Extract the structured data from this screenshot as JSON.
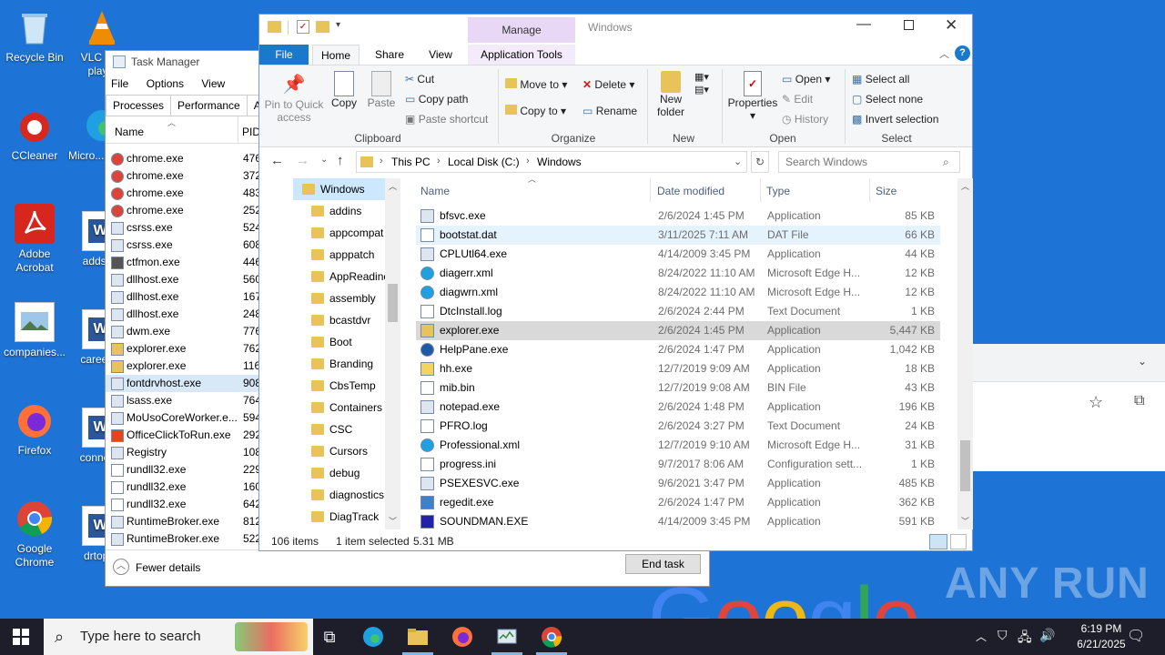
{
  "desktop": {
    "icons": [
      {
        "label": "Recycle Bin"
      },
      {
        "label": "VLC m... play..."
      },
      {
        "label": "CCleaner"
      },
      {
        "label": "Micro... Edg..."
      },
      {
        "label": "Adobe Acrobat"
      },
      {
        "label": "addsh..."
      },
      {
        "label": "companies..."
      },
      {
        "label": "careerf..."
      },
      {
        "label": "Firefox"
      },
      {
        "label": "connec..."
      },
      {
        "label": "Google Chrome"
      },
      {
        "label": "drtopi..."
      }
    ]
  },
  "task_manager": {
    "title": "Task Manager",
    "menu": [
      "File",
      "Options",
      "View"
    ],
    "tabs": [
      "Processes",
      "Performance",
      "App"
    ],
    "col_name": "Name",
    "col_pid": "PID",
    "processes": [
      {
        "name": "chrome.exe",
        "pid": "476",
        "icon": "chrome-icon"
      },
      {
        "name": "chrome.exe",
        "pid": "372",
        "icon": "chrome-icon"
      },
      {
        "name": "chrome.exe",
        "pid": "483",
        "icon": "chrome-icon"
      },
      {
        "name": "chrome.exe",
        "pid": "252",
        "icon": "chrome-icon"
      },
      {
        "name": "csrss.exe",
        "pid": "524",
        "icon": "app-icon"
      },
      {
        "name": "csrss.exe",
        "pid": "608",
        "icon": "app-icon"
      },
      {
        "name": "ctfmon.exe",
        "pid": "446",
        "icon": "ctfmon-icon"
      },
      {
        "name": "dllhost.exe",
        "pid": "560",
        "icon": "app-icon"
      },
      {
        "name": "dllhost.exe",
        "pid": "167",
        "icon": "app-icon"
      },
      {
        "name": "dllhost.exe",
        "pid": "248",
        "icon": "app-icon"
      },
      {
        "name": "dwm.exe",
        "pid": "776",
        "icon": "app-icon"
      },
      {
        "name": "explorer.exe",
        "pid": "762",
        "icon": "explorer-icon"
      },
      {
        "name": "explorer.exe",
        "pid": "116",
        "icon": "explorer-icon"
      },
      {
        "name": "fontdrvhost.exe",
        "pid": "908",
        "icon": "app-icon"
      },
      {
        "name": "lsass.exe",
        "pid": "764",
        "icon": "app-icon"
      },
      {
        "name": "MoUsoCoreWorker.e...",
        "pid": "594",
        "icon": "app-icon"
      },
      {
        "name": "OfficeClickToRun.exe",
        "pid": "292",
        "icon": "office-icon"
      },
      {
        "name": "Registry",
        "pid": "108",
        "icon": "app-icon"
      },
      {
        "name": "rundll32.exe",
        "pid": "229",
        "icon": "doc-icon"
      },
      {
        "name": "rundll32.exe",
        "pid": "160",
        "icon": "doc-icon"
      },
      {
        "name": "rundll32.exe",
        "pid": "642",
        "icon": "doc-icon"
      },
      {
        "name": "RuntimeBroker.exe",
        "pid": "812",
        "icon": "app-icon"
      },
      {
        "name": "RuntimeBroker.exe",
        "pid": "522",
        "icon": "app-icon"
      }
    ],
    "fewer_details": "Fewer details",
    "end_task": "End task"
  },
  "explorer": {
    "title": "Windows",
    "manage_label": "Manage",
    "tabs": {
      "file": "File",
      "home": "Home",
      "share": "Share",
      "view": "View",
      "app_tools": "Application Tools"
    },
    "ribbon": {
      "pin": "Pin to Quick access",
      "copy": "Copy",
      "paste": "Paste",
      "cut": "Cut",
      "copy_path": "Copy path",
      "paste_shortcut": "Paste shortcut",
      "move_to": "Move to",
      "copy_to": "Copy to",
      "delete": "Delete",
      "rename": "Rename",
      "new_folder": "New folder",
      "properties": "Properties",
      "open": "Open",
      "edit": "Edit",
      "history": "History",
      "select_all": "Select all",
      "select_none": "Select none",
      "invert_selection": "Invert selection",
      "groups": {
        "clipboard": "Clipboard",
        "organize": "Organize",
        "new": "New",
        "open": "Open",
        "select": "Select"
      }
    },
    "breadcrumb": [
      "This PC",
      "Local Disk (C:)",
      "Windows"
    ],
    "search_placeholder": "Search Windows",
    "tree": [
      "Windows",
      "addins",
      "appcompat",
      "apppatch",
      "AppReadine",
      "assembly",
      "bcastdvr",
      "Boot",
      "Branding",
      "CbsTemp",
      "Containers",
      "CSC",
      "Cursors",
      "debug",
      "diagnostics",
      "DiagTrack"
    ],
    "columns": {
      "name": "Name",
      "date": "Date modified",
      "type": "Type",
      "size": "Size"
    },
    "files": [
      {
        "name": "bfsvc.exe",
        "date": "2/6/2024 1:45 PM",
        "type": "Application",
        "size": "85 KB",
        "icon": "app-icon"
      },
      {
        "name": "bootstat.dat",
        "date": "3/11/2025 7:11 AM",
        "type": "DAT File",
        "size": "66 KB",
        "icon": "file-icon"
      },
      {
        "name": "CPLUtl64.exe",
        "date": "4/14/2009 3:45 PM",
        "type": "Application",
        "size": "44 KB",
        "icon": "app-icon"
      },
      {
        "name": "diagerr.xml",
        "date": "8/24/2022 11:10 AM",
        "type": "Microsoft Edge H...",
        "size": "12 KB",
        "icon": "edge-icon"
      },
      {
        "name": "diagwrn.xml",
        "date": "8/24/2022 11:10 AM",
        "type": "Microsoft Edge H...",
        "size": "12 KB",
        "icon": "edge-icon"
      },
      {
        "name": "DtcInstall.log",
        "date": "2/6/2024 2:44 PM",
        "type": "Text Document",
        "size": "1 KB",
        "icon": "text-icon"
      },
      {
        "name": "explorer.exe",
        "date": "2/6/2024 1:45 PM",
        "type": "Application",
        "size": "5,447 KB",
        "icon": "explorer-icon"
      },
      {
        "name": "HelpPane.exe",
        "date": "2/6/2024 1:47 PM",
        "type": "Application",
        "size": "1,042 KB",
        "icon": "help-icon"
      },
      {
        "name": "hh.exe",
        "date": "12/7/2019 9:09 AM",
        "type": "Application",
        "size": "18 KB",
        "icon": "hh-icon"
      },
      {
        "name": "mib.bin",
        "date": "12/7/2019 9:08 AM",
        "type": "BIN File",
        "size": "43 KB",
        "icon": "file-icon"
      },
      {
        "name": "notepad.exe",
        "date": "2/6/2024 1:48 PM",
        "type": "Application",
        "size": "196 KB",
        "icon": "app-icon"
      },
      {
        "name": "PFRO.log",
        "date": "2/6/2024 3:27 PM",
        "type": "Text Document",
        "size": "24 KB",
        "icon": "text-icon"
      },
      {
        "name": "Professional.xml",
        "date": "12/7/2019 9:10 AM",
        "type": "Microsoft Edge H...",
        "size": "31 KB",
        "icon": "edge-icon"
      },
      {
        "name": "progress.ini",
        "date": "9/7/2017 8:06 AM",
        "type": "Configuration sett...",
        "size": "1 KB",
        "icon": "ini-icon"
      },
      {
        "name": "PSEXESVC.exe",
        "date": "9/6/2021 3:47 PM",
        "type": "Application",
        "size": "485 KB",
        "icon": "app-icon"
      },
      {
        "name": "regedit.exe",
        "date": "2/6/2024 1:47 PM",
        "type": "Application",
        "size": "362 KB",
        "icon": "regedit-icon"
      },
      {
        "name": "SOUNDMAN.EXE",
        "date": "4/14/2009 3:45 PM",
        "type": "Application",
        "size": "591 KB",
        "icon": "soundman-icon"
      }
    ],
    "status": {
      "count": "106 items",
      "selected": "1 item selected",
      "size": "5.31 MB"
    }
  },
  "taskbar": {
    "search_placeholder": "Type here to search",
    "time": "6:19 PM",
    "date": "6/21/2025"
  },
  "watermark": "ANY RUN",
  "google_logo": "Google"
}
